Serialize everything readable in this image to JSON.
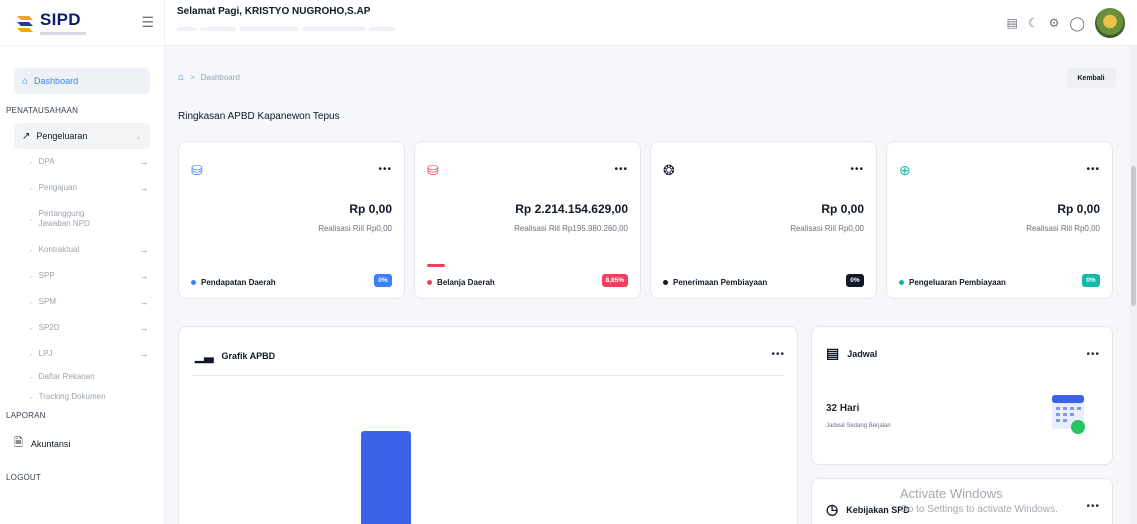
{
  "brand": {
    "name": "SIPD"
  },
  "header": {
    "greeting": "Selamat Pagi, KRISTYO NUGROHO,S.AP",
    "chips": [
      "",
      "",
      "",
      "",
      ""
    ]
  },
  "sidebar": {
    "dashboard": "Dashboard",
    "section_penatausahaan": "PENATAUSAHAAN",
    "group_pengeluaran": "Pengeluaran",
    "sub_items": [
      {
        "label": "DPA",
        "has_arrow": true
      },
      {
        "label": "Pengajuan",
        "has_arrow": true
      },
      {
        "label": "Pertanggung Jawaban NPD",
        "has_arrow": false
      },
      {
        "label": "Kontraktual",
        "has_arrow": true
      },
      {
        "label": "SPP",
        "has_arrow": true
      },
      {
        "label": "SPM",
        "has_arrow": true
      },
      {
        "label": "SP2D",
        "has_arrow": true
      },
      {
        "label": "LPJ",
        "has_arrow": true
      },
      {
        "label": "Daftar Rekanan",
        "has_arrow": false
      },
      {
        "label": "Tracking Dokumen",
        "has_arrow": false
      }
    ],
    "section_laporan": "LAPORAN",
    "akuntansi": "Akuntansi",
    "logout": "LOGOUT"
  },
  "main": {
    "breadcrumb": "Dashboard",
    "back_label": "Kembali",
    "title": "Ringkasan APBD Kapanewon Tepus"
  },
  "cards": [
    {
      "amount": "Rp 0,00",
      "realisasi": "Realisasi Riil Rp0,00",
      "sub": "",
      "label": "Pendapatan Daerah",
      "pct": "0%",
      "color": "#3b82f6",
      "pct_color": "#3b82f6",
      "progress": 0
    },
    {
      "amount": "Rp 2.214.154.629,00",
      "realisasi": "Realisasi Riil Rp195.980.260,00",
      "sub": "",
      "label": "Belanja Daerah",
      "pct": "8,85%",
      "color": "#f43f5e",
      "pct_color": "#f43f5e",
      "progress": 0.0885
    },
    {
      "amount": "Rp 0,00",
      "realisasi": "Realisasi Riil Rp0,00",
      "sub": "",
      "label": "Penerimaan Pembiayaan",
      "pct": "0%",
      "color": "#111827",
      "pct_color": "#111827",
      "progress": 0
    },
    {
      "amount": "Rp 0,00",
      "realisasi": "Realisasi Riil Rp0,00",
      "sub": "",
      "label": "Pengeluaran Pembiayaan",
      "pct": "0%",
      "color": "#14b8a6",
      "pct_color": "#14b8a6",
      "progress": 0
    }
  ],
  "grafik": {
    "title": "Grafik APBD"
  },
  "jadwal": {
    "title": "Jadwal",
    "days": "32 Hari",
    "status": "Jadwal Sedang Berjalan"
  },
  "kebijakan": {
    "title": "Kebijakan SPD"
  },
  "watermark": {
    "line1": "Activate Windows",
    "line2": "Go to Settings to activate Windows."
  }
}
